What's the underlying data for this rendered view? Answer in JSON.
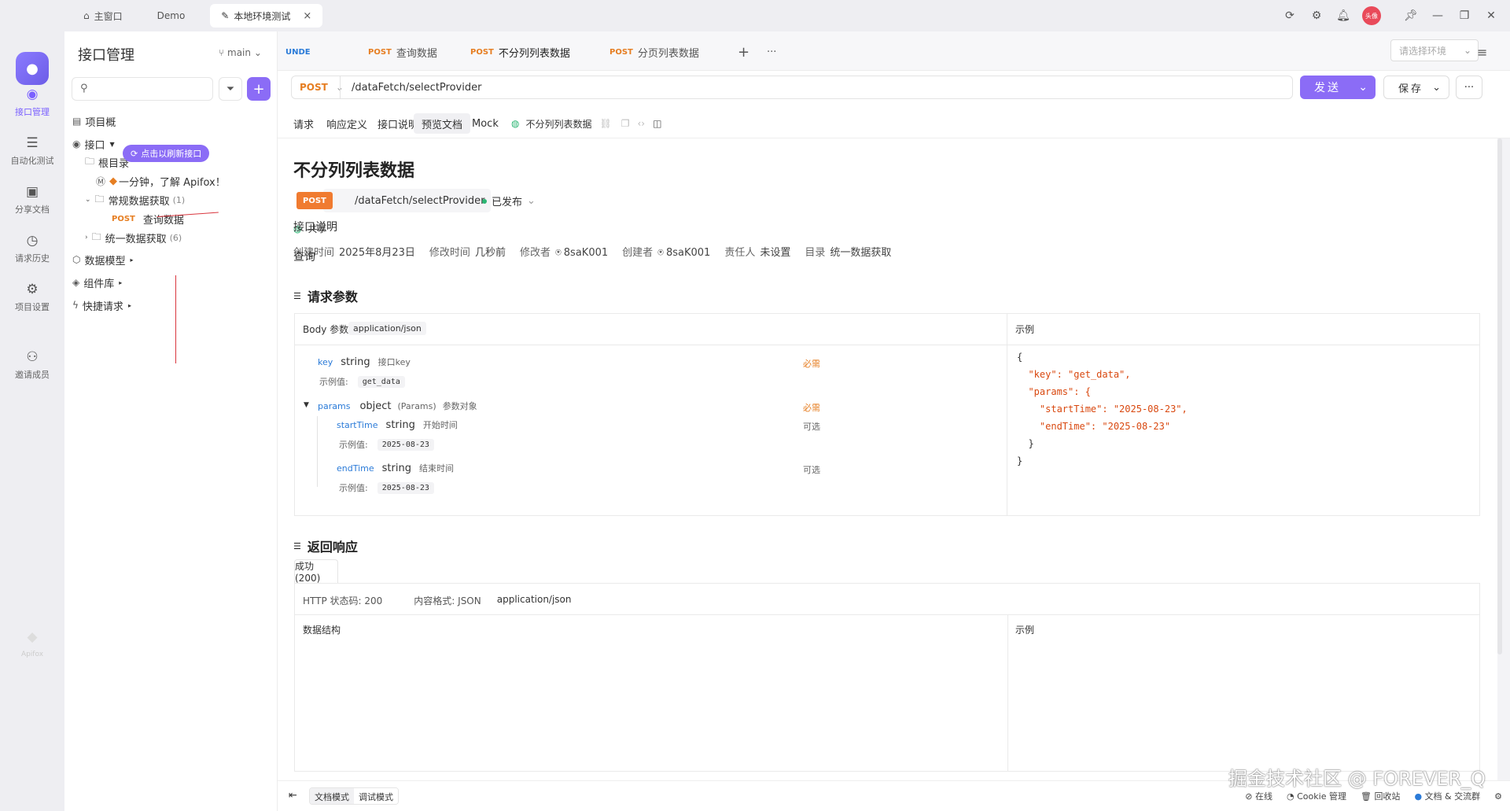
{
  "titlebar": {
    "tabs": [
      {
        "label": "主窗口",
        "icon": "home-icon"
      },
      {
        "label": "Demo"
      },
      {
        "label": "本地环境测试",
        "icon": "edit-icon"
      }
    ],
    "close": "×",
    "avatar": "头像"
  },
  "rail": {
    "items": [
      {
        "label": "接口管理"
      },
      {
        "label": "自动化测试"
      },
      {
        "label": "分享文档"
      },
      {
        "label": "请求历史"
      },
      {
        "label": "项目设置"
      },
      {
        "label": "邀请成员"
      }
    ],
    "brand": "Apifox"
  },
  "sidebar": {
    "title": "接口管理",
    "branch": "main",
    "add_label": "+",
    "tree": {
      "overview": "项目概",
      "refresh_pill": "点击以刷新接口",
      "interfaces": "接口",
      "root": "根目录",
      "intro_doc": "一分钟，了解 Apifox！",
      "folder1": "常规数据获取",
      "folder1_count": "(1)",
      "item_method": "POST",
      "item_name": "查询数据",
      "folder2": "统一数据获取",
      "folder2_count": "(6)",
      "data_model": "数据模型",
      "components": "组件库",
      "quick_request": "快捷请求"
    }
  },
  "editor_tabs": [
    {
      "method": "",
      "label": "UNDE"
    },
    {
      "method": "POST",
      "label": "查询数据"
    },
    {
      "method": "POST",
      "label": "不分列列表数据"
    },
    {
      "method": "POST",
      "label": "分页列表数据"
    }
  ],
  "env_placeholder": "请选择环境",
  "request": {
    "method": "POST",
    "url": "/dataFetch/selectProvider",
    "send": "发送",
    "save": "保存"
  },
  "subtabs": [
    "请求",
    "响应定义",
    "接口说明",
    "预览文档",
    "Mock"
  ],
  "subtab_name": "不分列列表数据",
  "doc": {
    "title": "不分列列表数据",
    "method": "POST",
    "path": "/dataFetch/selectProvider",
    "status": "已发布",
    "share": "共享",
    "meta": [
      {
        "k": "创建时间",
        "v": "2025年8月23日"
      },
      {
        "k": "修改时间",
        "v": "几秒前"
      },
      {
        "k": "修改者",
        "v": "8saK001"
      },
      {
        "k": "创建者",
        "v": "8saK001"
      },
      {
        "k": "责任人",
        "v": "未设置"
      },
      {
        "k": "目录",
        "v": "统一数据获取"
      }
    ],
    "desc_label": "接口说明",
    "desc_text": "查询",
    "req_params_title": "请求参数",
    "body_label": "Body 参数",
    "content_type": "application/json",
    "example_label": "示例",
    "example_value_label": "示例值:",
    "required": "必需",
    "optional": "可选",
    "params": {
      "key": {
        "name": "key",
        "type": "string",
        "desc": "接口key",
        "example": "get_data"
      },
      "params": {
        "name": "params",
        "type": "object",
        "sub": "(Params)",
        "desc": "参数对象"
      },
      "startTime": {
        "name": "startTime",
        "type": "string",
        "desc": "开始时间",
        "example": "2025-08-23"
      },
      "endTime": {
        "name": "endTime",
        "type": "string",
        "desc": "结束时间",
        "example": "2025-08-23"
      }
    },
    "code_lines": [
      "{",
      "  \"key\": \"get_data\",",
      "  \"params\": {",
      "    \"startTime\": \"2025-08-23\",",
      "    \"endTime\": \"2025-08-23\"",
      "  }",
      "}"
    ],
    "resp_title": "返回响应",
    "resp_tab": "成功(200)",
    "http_code": "HTTP 状态码: 200",
    "resp_format": "内容格式: JSON",
    "resp_type": "application/json",
    "data_struct": "数据结构"
  },
  "footer": {
    "doc_mode": "文档模式",
    "debug_mode": "调试模式",
    "online": "在线",
    "cookie": "Cookie 管理",
    "recycle": "回收站",
    "community": "文档 & 交流群"
  },
  "watermark": "掘金技术社区 @ FOREVER_Q"
}
